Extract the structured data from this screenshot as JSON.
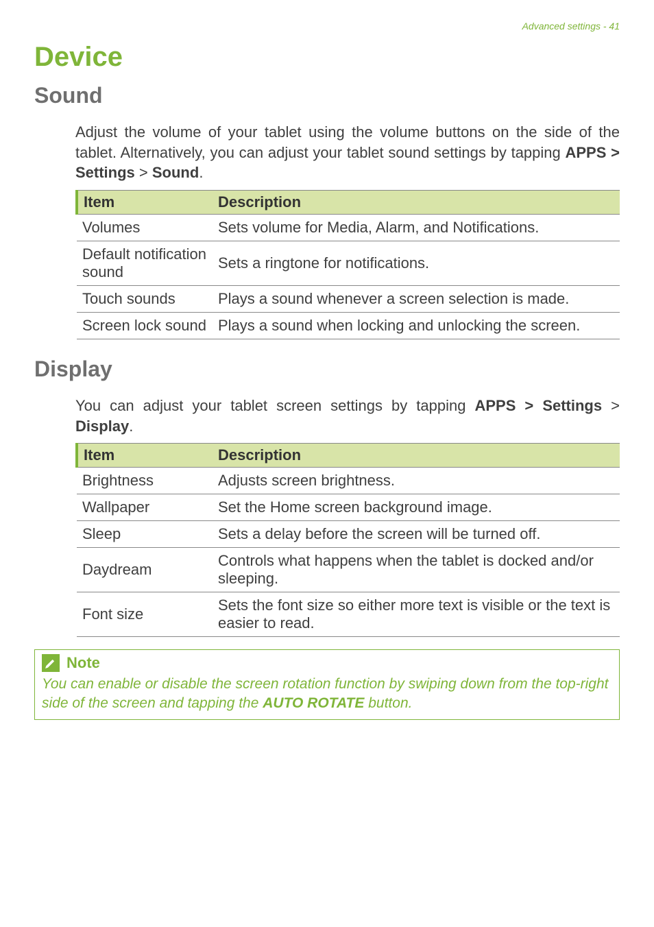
{
  "header": {
    "text": "Advanced settings - 41"
  },
  "h1": "Device",
  "sound": {
    "heading": "Sound",
    "intro_parts": {
      "p1": "Adjust the volume of your tablet using the volume buttons on the side of the tablet. Alternatively, you can adjust your tablet sound settings by tapping ",
      "apps": "APPS",
      "sep1": " > ",
      "settings": "Settings",
      "gt": " > ",
      "sound": "Sound",
      "period": "."
    },
    "table": {
      "col1": "Item",
      "col2": "Description",
      "rows": [
        {
          "item": "Volumes",
          "desc": "Sets volume for Media, Alarm, and Notifications."
        },
        {
          "item": "Default notification sound",
          "desc": "Sets a ringtone for notifications."
        },
        {
          "item": "Touch sounds",
          "desc": "Plays a sound whenever a screen selection is made."
        },
        {
          "item": "Screen lock sound",
          "desc": "Plays a sound when locking and unlocking the screen."
        }
      ]
    }
  },
  "display": {
    "heading": "Display",
    "intro_parts": {
      "p1": "You can adjust your tablet screen settings by tapping ",
      "apps": "APPS",
      "sep1": " > ",
      "settings": "Settings",
      "gt": " > ",
      "display": "Display",
      "period": "."
    },
    "table": {
      "col1": "Item",
      "col2": "Description",
      "rows": [
        {
          "item": "Brightness",
          "desc": "Adjusts screen brightness."
        },
        {
          "item": "Wallpaper",
          "desc": "Set the Home screen background image."
        },
        {
          "item": "Sleep",
          "desc": "Sets a delay before the screen will be turned off."
        },
        {
          "item": "Daydream",
          "desc": "Controls what happens when the tablet is docked and/or sleeping."
        },
        {
          "item": "Font size",
          "desc": "Sets the font size so either more text is visible or the text is easier to read."
        }
      ]
    }
  },
  "note": {
    "title": "Note",
    "body_parts": {
      "p1": "You can enable or disable the screen rotation function by swiping down from the top-right side of the screen and tapping the ",
      "auto_rotate": "AUTO ROTATE",
      "p2": " button."
    }
  }
}
